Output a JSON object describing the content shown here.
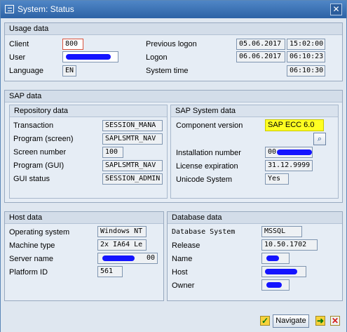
{
  "window": {
    "title": "System: Status"
  },
  "usage": {
    "header": "Usage data",
    "client_label": "Client",
    "client_value": "800",
    "user_label": "User",
    "language_label": "Language",
    "language_value": "EN",
    "prev_logon_label": "Previous logon",
    "prev_logon_date": "05.06.2017",
    "prev_logon_time": "15:02:00",
    "logon_label": "Logon",
    "logon_date": "06.06.2017",
    "logon_time": "06:10:23",
    "systime_label": "System time",
    "systime_value": "06:10:30"
  },
  "sap": {
    "header": "SAP data",
    "repo": {
      "header": "Repository data",
      "rows": [
        {
          "label": "Transaction",
          "value": "SESSION_MANA"
        },
        {
          "label": "Program (screen)",
          "value": "SAPLSMTR_NAV"
        },
        {
          "label": "Screen number",
          "value": "100"
        },
        {
          "label": "Program (GUI)",
          "value": "SAPLSMTR_NAV"
        },
        {
          "label": "GUI status",
          "value": "SESSION_ADMIN"
        }
      ]
    },
    "system": {
      "header": "SAP System data",
      "component_label": "Component version",
      "component_value": "SAP ECC 6.0",
      "install_label": "Installation number",
      "install_value": "00",
      "license_label": "License expiration",
      "license_value": "31.12.9999",
      "unicode_label": "Unicode System",
      "unicode_value": "Yes"
    }
  },
  "host": {
    "header": "Host data",
    "os_label": "Operating system",
    "os_value": "Windows NT",
    "machine_label": "Machine type",
    "machine_value": "2x IA64 Le",
    "server_label": "Server name",
    "server_value": "00",
    "platform_label": "Platform ID",
    "platform_value": "561"
  },
  "db": {
    "header": "Database data",
    "system_label": "Database System",
    "system_value": "MSSQL",
    "release_label": "Release",
    "release_value": "10.50.1702",
    "name_label": "Name",
    "host_label": "Host",
    "owner_label": "Owner"
  },
  "footer": {
    "navigate_label": "Navigate"
  },
  "icons": {
    "close": "close-icon",
    "details": "magnifier-icon",
    "ok": "checkmark-icon",
    "next": "next-icon",
    "cancel": "cancel-icon"
  },
  "colors": {
    "highlight": "#ffff22",
    "redaction": "#1414ff"
  }
}
